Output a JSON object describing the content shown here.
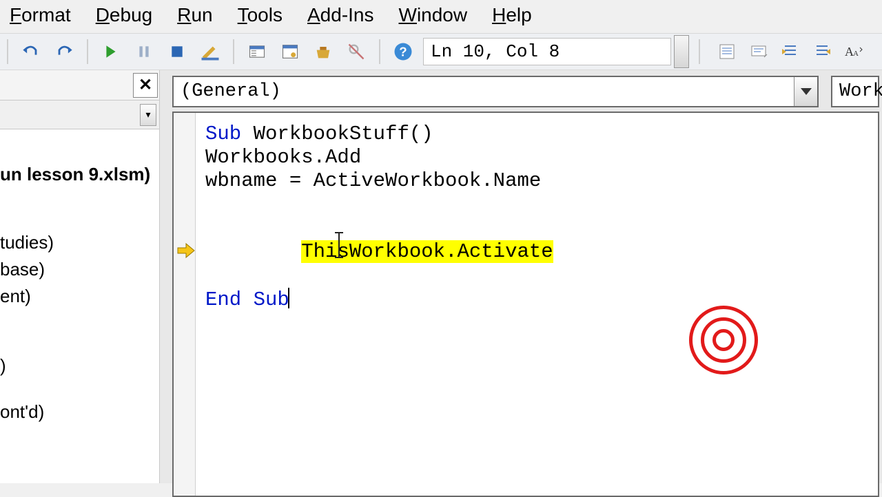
{
  "menu": {
    "format": "Format",
    "debug": "Debug",
    "run": "Run",
    "tools": "Tools",
    "addins": "Add-Ins",
    "window": "Window",
    "help": "Help"
  },
  "toolbar": {
    "cursor_status": "Ln 10, Col 8"
  },
  "dropdown": {
    "object": "(General)",
    "procedure_partial": "Work"
  },
  "sidebar": {
    "title_fragment": "un lesson 9.xlsm)",
    "items": [
      "tudies)",
      "base)",
      "ent)",
      ")",
      "ont'd)"
    ]
  },
  "code": {
    "l1a": "Sub",
    "l1b": " WorkbookStuff()",
    "l2": "",
    "l3": "Workbooks.Add",
    "l4": "",
    "l5": "wbname = ActiveWorkbook.Name",
    "l6": "",
    "l7": "ThisWorkbook.Activate",
    "l8": "",
    "l9": "",
    "l10a": "End Sub",
    "current_exec_line": "ThisWorkbook.Activate"
  }
}
